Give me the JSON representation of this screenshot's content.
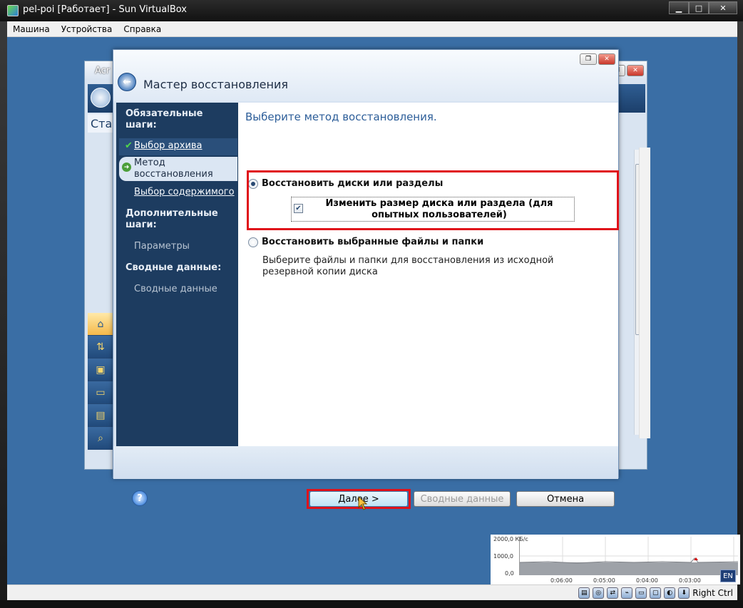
{
  "vbox": {
    "title": "pel-poi [Работает] - Sun VirtualBox",
    "menus": [
      "Машина",
      "Устройства",
      "Справка"
    ],
    "host_key": "Right Ctrl"
  },
  "background_window": {
    "title": "Acr",
    "subtitle": "Ста"
  },
  "wizard": {
    "title": "Мастер восстановления",
    "sidebar": {
      "required_heading": "Обязательные шаги:",
      "steps": [
        {
          "label": "Выбор архива",
          "state": "done"
        },
        {
          "label": "Метод восстановления",
          "state": "current"
        },
        {
          "label": "Выбор содержимого",
          "state": "link"
        }
      ],
      "optional_heading": "Дополнительные шаги:",
      "optional_steps": [
        {
          "label": "Параметры",
          "state": "disabled"
        }
      ],
      "summary_heading": "Сводные данные:",
      "summary_steps": [
        {
          "label": "Сводные данные",
          "state": "disabled"
        }
      ]
    },
    "content": {
      "heading": "Выберите метод восстановления.",
      "option_disks": "Восстановить диски или разделы",
      "option_disks_selected": true,
      "resize_checkbox": "Изменить размер диска или раздела (для опытных пользователей)",
      "resize_checked": true,
      "option_files": "Восстановить выбранные файлы и папки",
      "option_files_selected": false,
      "option_files_desc": "Выберите файлы и папки для восстановления из исходной резервной копии диска"
    },
    "buttons": {
      "next": "Далее >",
      "summary": "Сводные данные",
      "cancel": "Отмена"
    }
  },
  "net_graph": {
    "y_labels": [
      "2000,0 КБ/с",
      "1000,0",
      "0,0"
    ],
    "x_labels": [
      "0:06:00",
      "0:05:00",
      "0:04:00",
      "0:03:00"
    ]
  },
  "lang_indicator": "EN",
  "colors": {
    "highlight": "#e0121a",
    "sidebar_bg": "#1d3c60",
    "heading_blue": "#2d5e99",
    "desktop": "#3a6ea5"
  }
}
